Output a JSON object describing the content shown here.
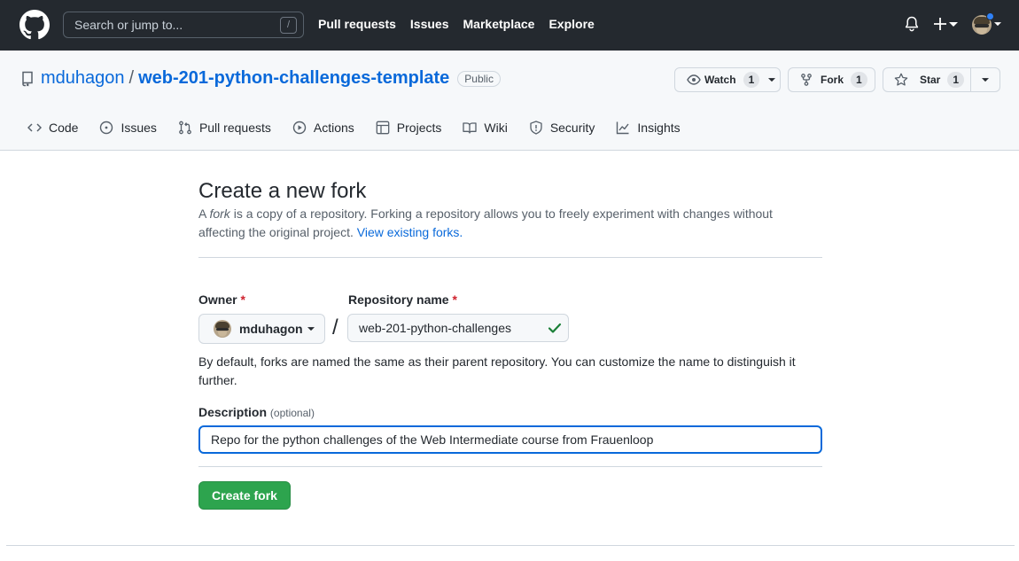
{
  "header": {
    "search_placeholder": "Search or jump to...",
    "search_shortcut": "/",
    "nav": [
      "Pull requests",
      "Issues",
      "Marketplace",
      "Explore"
    ]
  },
  "repo": {
    "owner": "mduhagon",
    "separator": "/",
    "name": "web-201-python-challenges-template",
    "visibility": "Public",
    "watch_label": "Watch",
    "watch_count": "1",
    "fork_label": "Fork",
    "fork_count": "1",
    "star_label": "Star",
    "star_count": "1"
  },
  "tabs": [
    "Code",
    "Issues",
    "Pull requests",
    "Actions",
    "Projects",
    "Wiki",
    "Security",
    "Insights"
  ],
  "form": {
    "title": "Create a new fork",
    "intro_a": "A ",
    "intro_fork_word": "fork",
    "intro_rest": " is a copy of a repository. Forking a repository allows you to freely experiment with changes without affecting the original project. ",
    "intro_link": "View existing forks.",
    "owner_label": "Owner",
    "required_mark": "*",
    "repo_name_label": "Repository name",
    "owner_value": "mduhagon",
    "slash": "/",
    "repo_name_value": "web-201-python-challenges",
    "hint": "By default, forks are named the same as their parent repository. You can customize the name to distinguish it further.",
    "description_label": "Description",
    "description_optional": "(optional)",
    "description_value": "Repo for the python challenges of the Web Intermediate course from Frauenloop",
    "submit_label": "Create fork"
  },
  "colors": {
    "header_bg": "#24292f",
    "link": "#0969da",
    "primary_button": "#2da44e",
    "success_check": "#1a7f37",
    "required": "#cf222e"
  }
}
